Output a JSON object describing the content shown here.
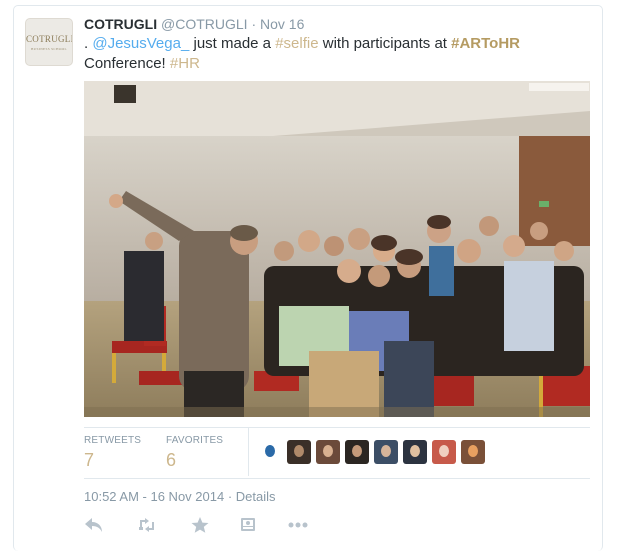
{
  "author": {
    "fullname": "COTRUGLI",
    "username": "@COTRUGLI",
    "separator": "·",
    "timestamp": "Nov 16",
    "avatar_logo_text": "COTRUGLI",
    "avatar_logo_sub": "BUSINESS SCHOOL"
  },
  "tweet": {
    "prefix": ". ",
    "mention": "@JesusVega_",
    "text1": " just made a ",
    "hashtag1": "#selfie",
    "text2": " with participants at ",
    "hashtag2": "#ARToHR",
    "text3": " Conference! ",
    "hashtag3": "#HR"
  },
  "stats": {
    "retweets_label": "RETWEETS",
    "retweets_value": "7",
    "favorites_label": "FAVORITES",
    "favorites_value": "6"
  },
  "favoriters": [
    {
      "name": "favoriter-1",
      "color": "#ffffff",
      "accent": "#2b6aa8"
    },
    {
      "name": "favoriter-2",
      "color": "#3a2f28",
      "accent": "#b08a6a"
    },
    {
      "name": "favoriter-3",
      "color": "#6b4a3a",
      "accent": "#d8b090"
    },
    {
      "name": "favoriter-4",
      "color": "#2b2622",
      "accent": "#c49a7a"
    },
    {
      "name": "favoriter-5",
      "color": "#3c4e66",
      "accent": "#d6b49a"
    },
    {
      "name": "favoriter-6",
      "color": "#2c3340",
      "accent": "#e0c0a0"
    },
    {
      "name": "favoriter-7",
      "color": "#c75a4a",
      "accent": "#f0d0c0"
    },
    {
      "name": "favoriter-8",
      "color": "#7a5038",
      "accent": "#e8a060"
    }
  ],
  "time_line": {
    "datetime": "10:52 AM - 16 Nov 2014",
    "separator": " · ",
    "details": "Details"
  },
  "actions": [
    "reply-icon",
    "retweet-icon",
    "favorite-icon",
    "photo-icon",
    "more-icon"
  ],
  "colors": {
    "link": "#55acee",
    "hashtag": "#cdb78d",
    "muted": "#8899a6",
    "text": "#292f33",
    "border": "#e1e8ed"
  }
}
